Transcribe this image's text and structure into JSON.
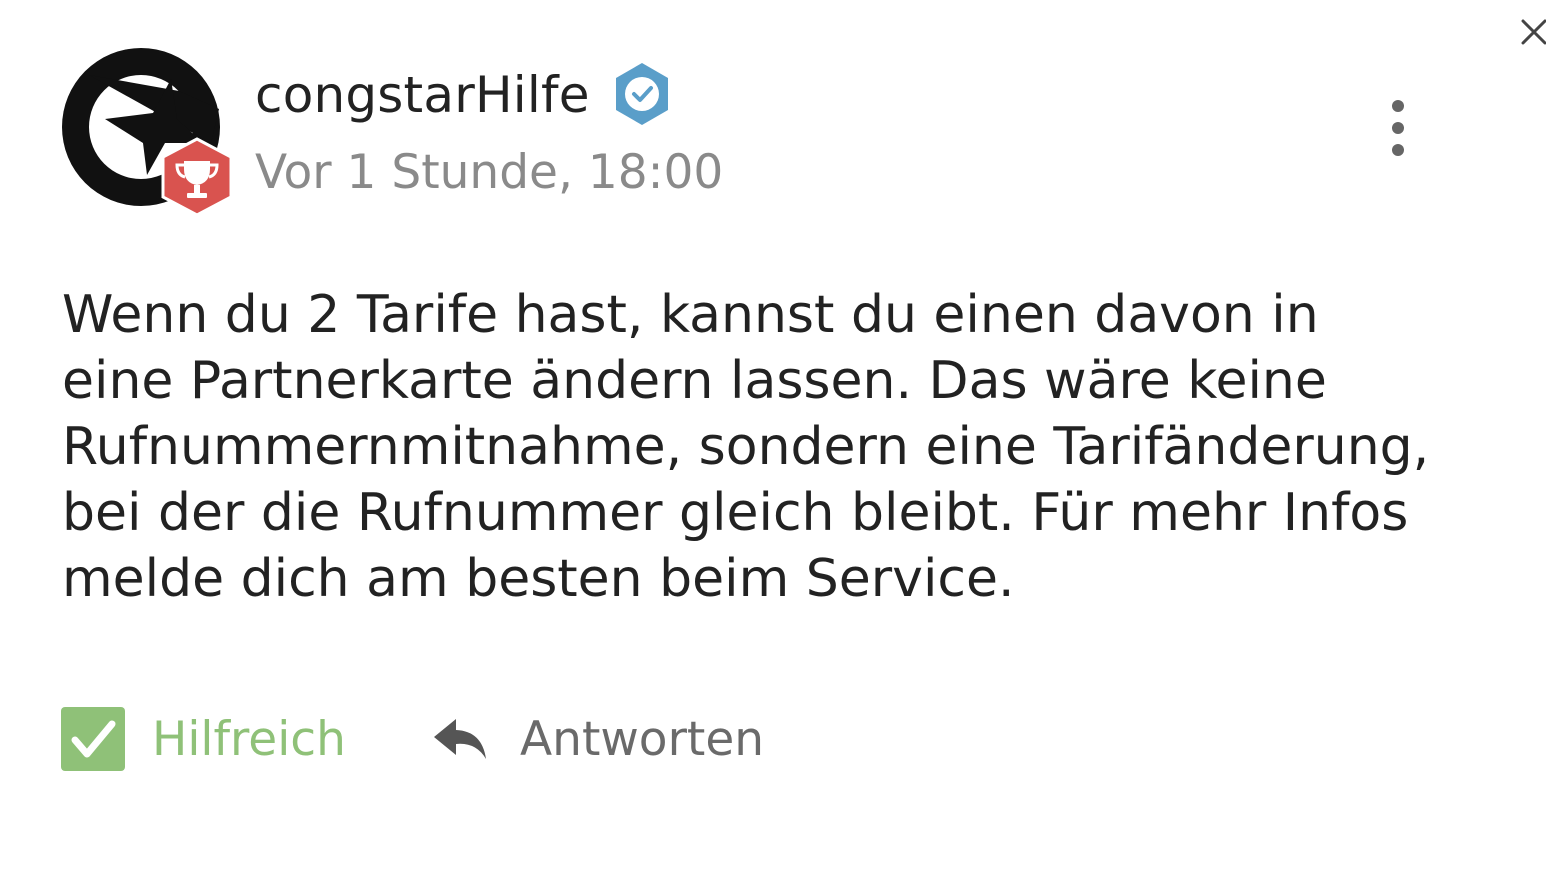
{
  "post": {
    "username": "congstarHilfe",
    "timestamp": "Vor 1 Stunde, 18:00",
    "body_lines": [
      "Wenn du 2 Tarife hast, kannst du einen davon in",
      "eine Partnerkarte ändern lassen. Das wäre keine",
      "Rufnummernmitnahme, sondern eine Tarifänderung,",
      "bei der die Rufnummer gleich bleibt. Für mehr Infos",
      "melde dich am besten beim Service."
    ]
  },
  "actions": {
    "helpful_label": "Hilfreich",
    "reply_label": "Antworten"
  },
  "icons": {
    "close": "close-icon",
    "avatar": "congstar-logo",
    "rank_badge": "trophy-icon",
    "verified": "verified-badge-icon",
    "more": "more-vertical-icon",
    "helpful": "checkbox-checked-icon",
    "reply": "reply-arrow-icon"
  },
  "colors": {
    "verified_badge": "#5a9ec9",
    "rank_badge": "#d9534f",
    "helpful_green": "#8fc178",
    "timestamp_gray": "#8a8a8a"
  }
}
